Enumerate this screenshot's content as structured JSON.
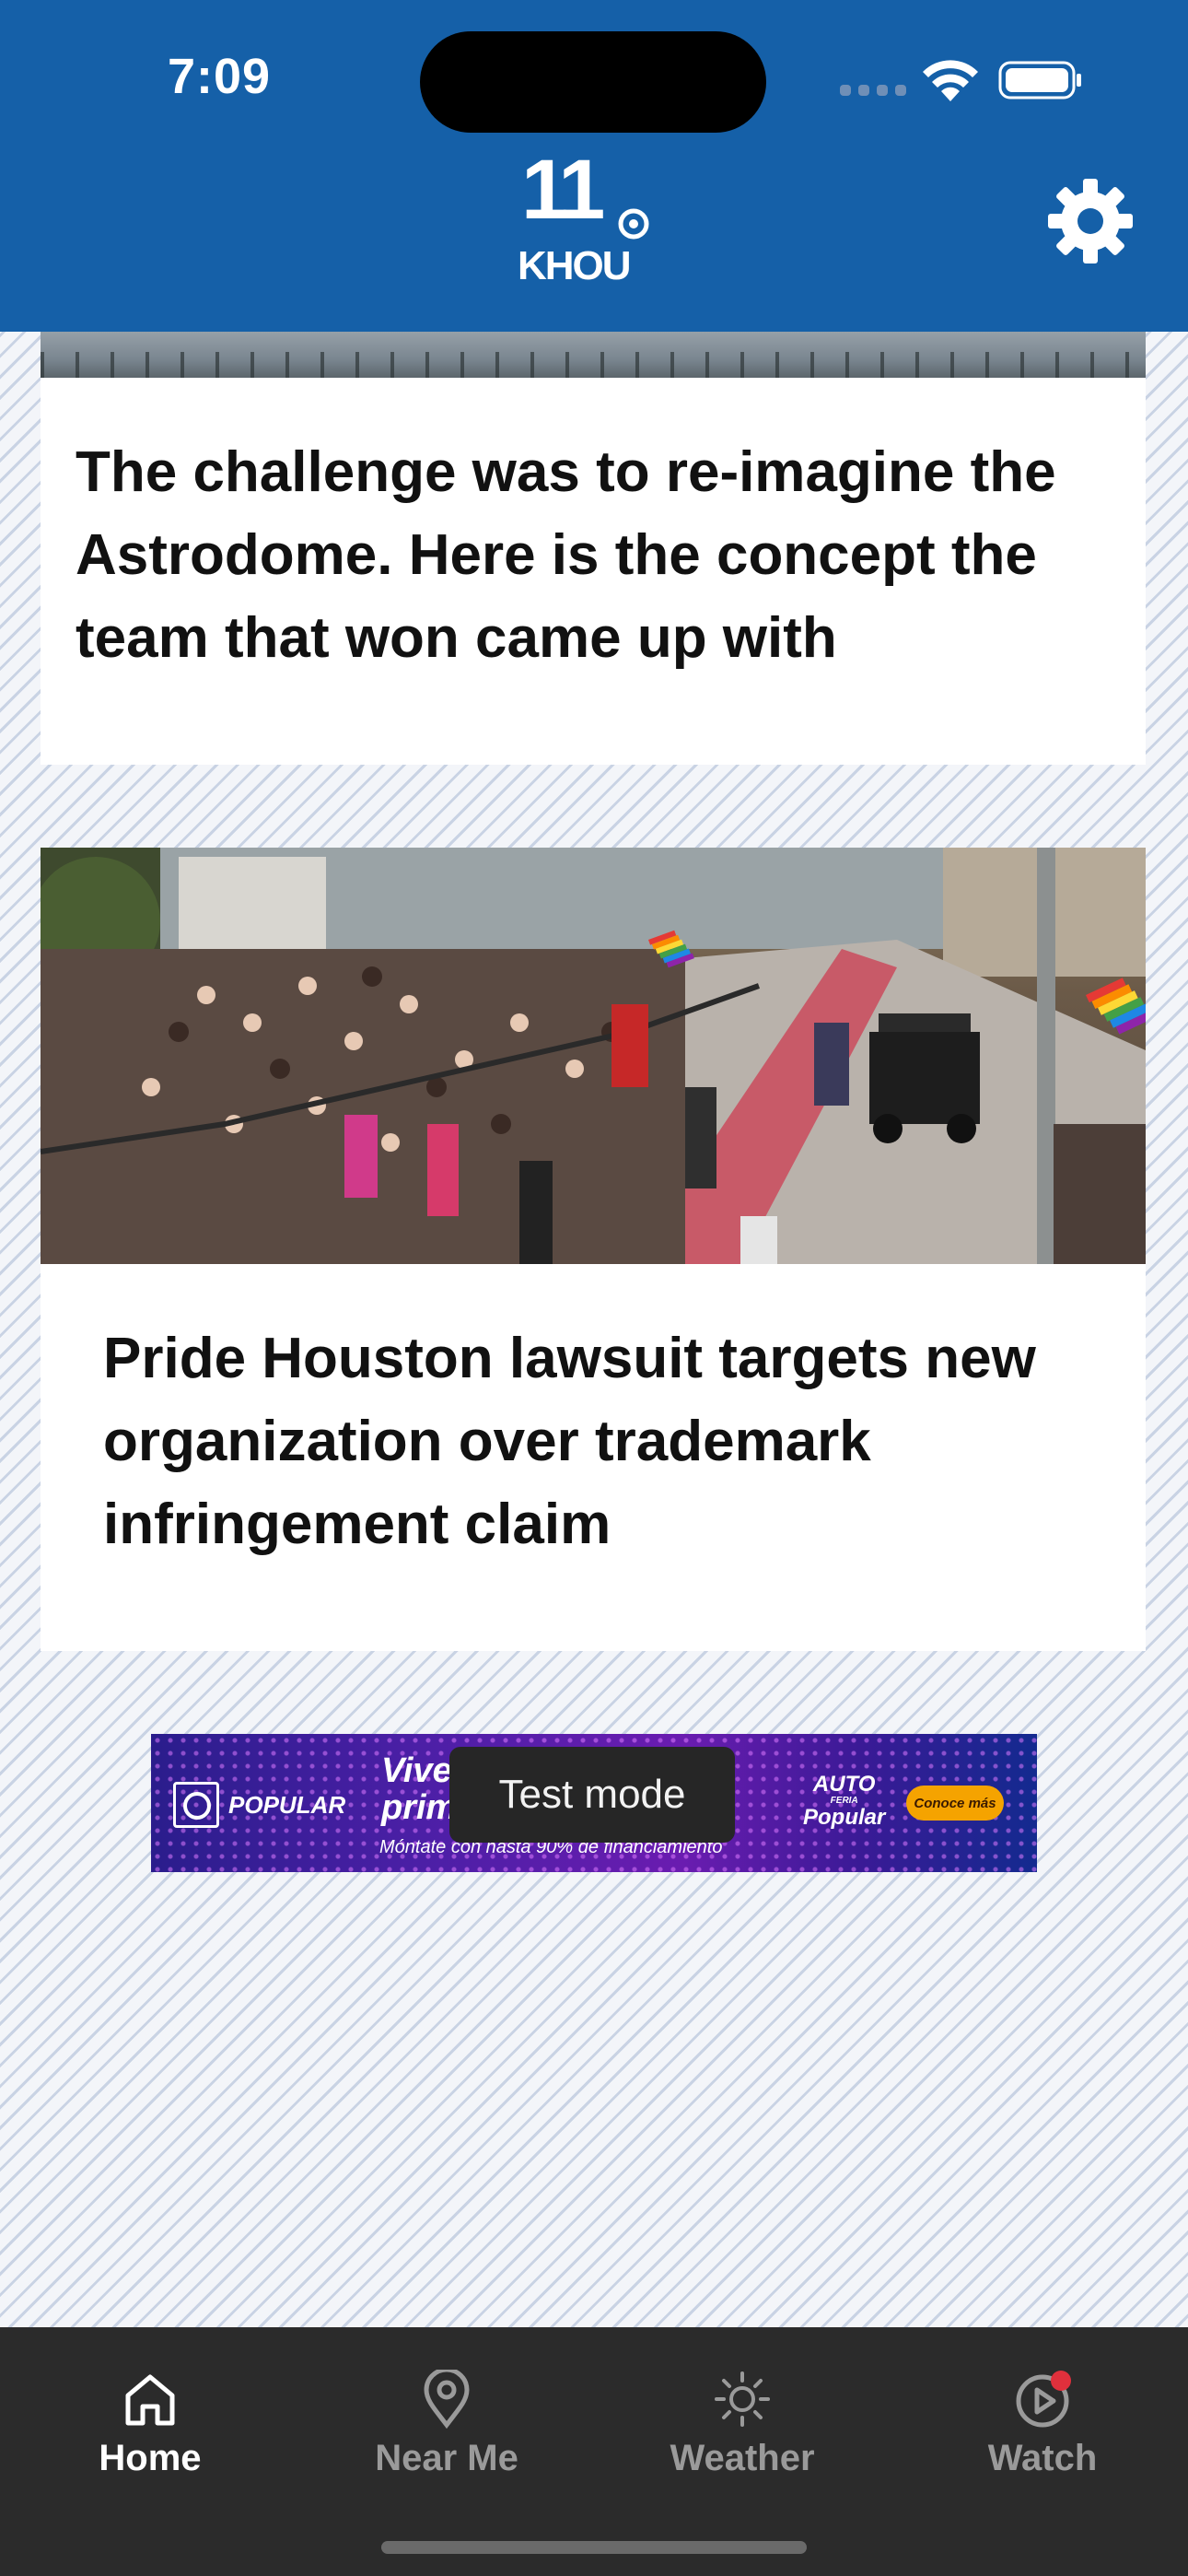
{
  "status_bar": {
    "time": "7:09"
  },
  "header": {
    "logo_text_number": "11",
    "logo_text_call": "KHOU",
    "settings_icon": "gear-icon"
  },
  "articles": [
    {
      "headline": "The challenge was to re-imagine the Astrodome. Here is the concept the team that won came up with"
    },
    {
      "headline": "Pride Houston lawsuit targets new organization over trademark infringement claim"
    }
  ],
  "ad": {
    "brand": "POPULAR",
    "headline": "Vive prim",
    "subtext": "Móntate con hasta 90% de financiamiento",
    "auto_badge_top": "AUTO",
    "auto_badge_mid": "FERIA",
    "auto_badge_bottom": "Popular",
    "cta": "Conoce más",
    "overlay": "Test mode"
  },
  "tabs": [
    {
      "label": "Home",
      "icon": "home-icon",
      "active": true
    },
    {
      "label": "Near Me",
      "icon": "location-pin-icon",
      "active": false
    },
    {
      "label": "Weather",
      "icon": "sun-icon",
      "active": false
    },
    {
      "label": "Watch",
      "icon": "play-icon",
      "active": false,
      "badge_color": "#e0303c"
    }
  ],
  "colors": {
    "header_bg": "#1560a8",
    "tabbar_bg": "#2b2b2b",
    "ad_cta": "#f5a300"
  }
}
